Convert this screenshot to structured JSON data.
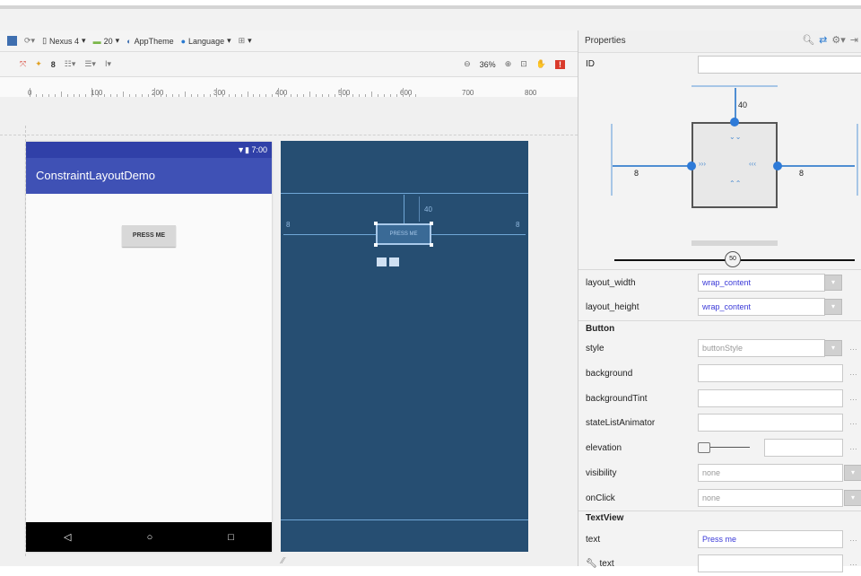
{
  "toolbar": {
    "device": "Nexus 4",
    "api": "20",
    "theme": "AppTheme",
    "language": "Language",
    "zoom": "36%"
  },
  "ruler": {
    "ticks": [
      "0",
      "100",
      "200",
      "300",
      "400",
      "500",
      "600",
      "700",
      "800"
    ]
  },
  "preview": {
    "time": "7:00",
    "app_title": "ConstraintLayoutDemo",
    "button_label": "PRESS ME"
  },
  "blueprint": {
    "button_label": "PRESS ME",
    "margin_top": "40",
    "margin_left": "8",
    "margin_right": "8"
  },
  "properties": {
    "title": "Properties",
    "id_label": "ID",
    "id_value": "",
    "inspector": {
      "top": "40",
      "left": "8",
      "right": "8",
      "bias": "50"
    },
    "layout_rows": [
      {
        "label": "layout_width",
        "value": "wrap_content"
      },
      {
        "label": "layout_height",
        "value": "wrap_content"
      }
    ],
    "button_section": "Button",
    "button_rows": [
      {
        "label": "style",
        "value": "buttonStyle"
      },
      {
        "label": "background",
        "value": ""
      },
      {
        "label": "backgroundTint",
        "value": ""
      },
      {
        "label": "stateListAnimator",
        "value": ""
      },
      {
        "label": "elevation",
        "value": ""
      },
      {
        "label": "visibility",
        "value": "none"
      },
      {
        "label": "onClick",
        "value": "none"
      }
    ],
    "textview_section": "TextView",
    "textview_rows": [
      {
        "label": "text",
        "value": "Press me"
      },
      {
        "label": "text",
        "value": ""
      }
    ]
  }
}
